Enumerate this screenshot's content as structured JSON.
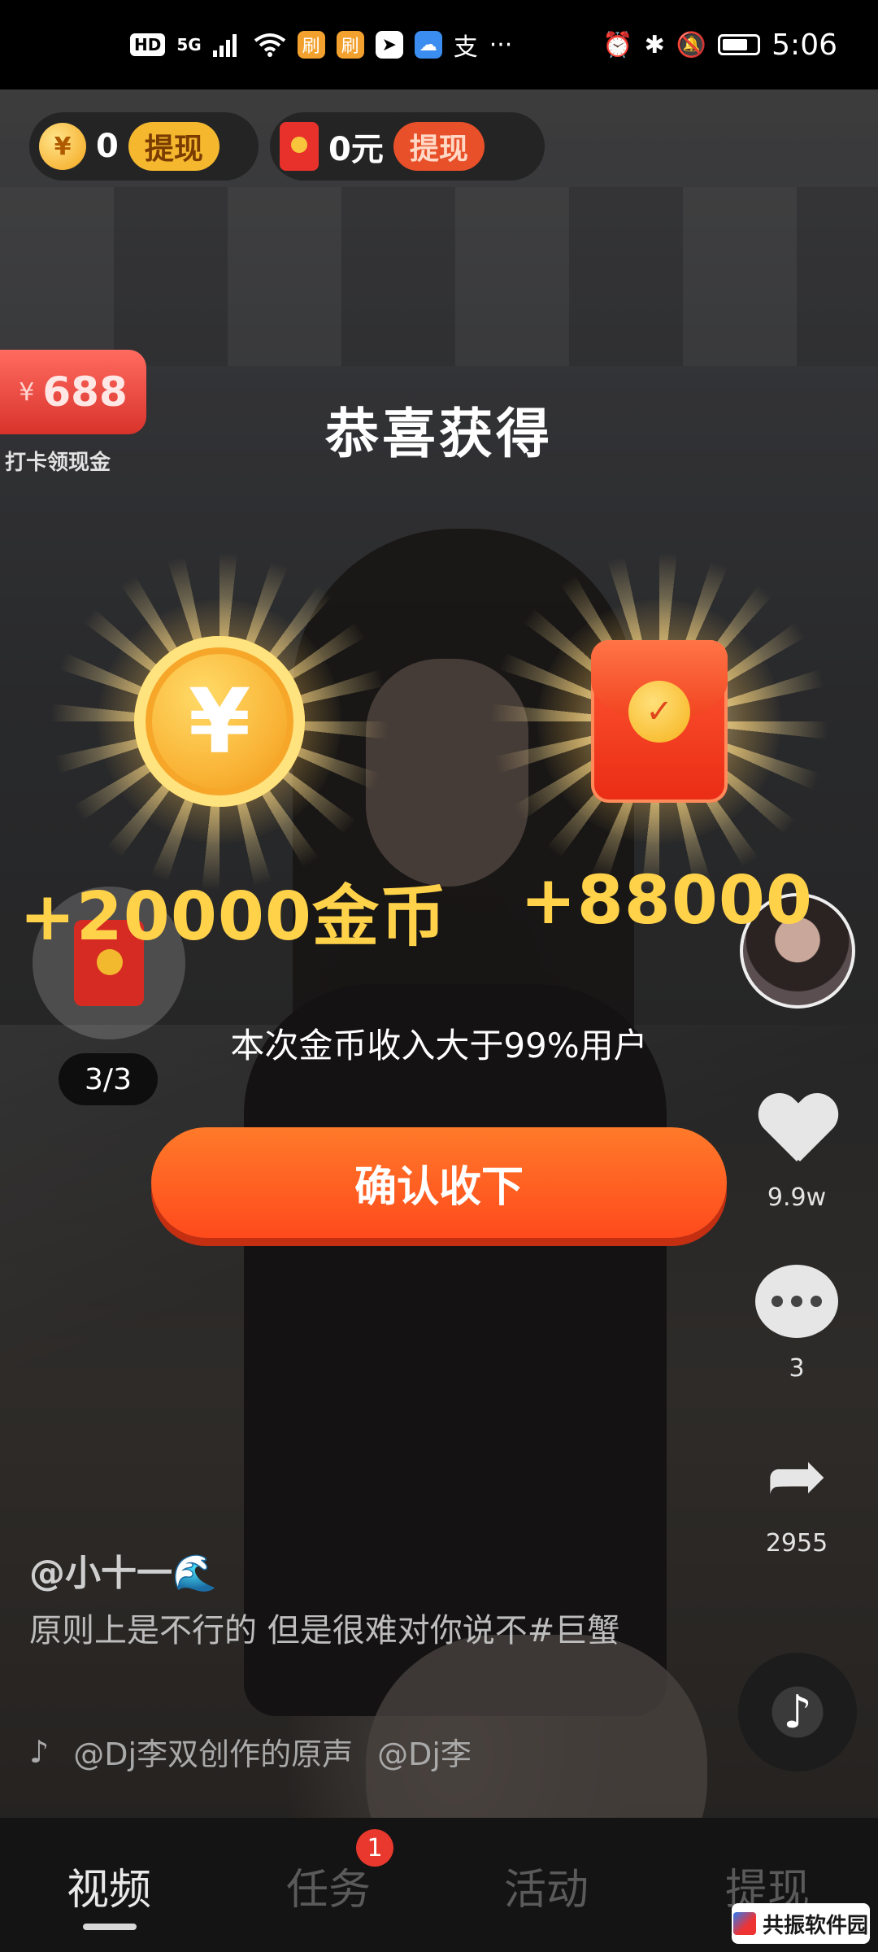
{
  "status_bar": {
    "left_badges": [
      "HD",
      "5G"
    ],
    "app_icon_names": [
      "signal-icon",
      "wifi-icon",
      "brush-app-icon",
      "brush-app-icon",
      "arrow-app-icon",
      "cloud-app-icon",
      "alipay-icon"
    ],
    "more": "···",
    "right_icon_names": [
      "alarm-icon",
      "bluetooth-icon",
      "mute-icon",
      "battery-icon"
    ],
    "time": "5:06"
  },
  "top_chips": {
    "coins": {
      "value": "0",
      "button": "提现"
    },
    "cash": {
      "value": "0元",
      "button": "提现"
    }
  },
  "checkin": {
    "currency": "¥",
    "amount": "688",
    "label": "打卡领现金"
  },
  "task": {
    "progress": "3/3"
  },
  "reward_dialog": {
    "title": "恭喜获得",
    "coin_symbol": "¥",
    "coin_reward": "+20000金币",
    "envelope_reward": "+88000",
    "subtext": "本次金币收入大于99%用户",
    "confirm_label": "确认收下"
  },
  "actions": {
    "likes": "9.9w",
    "comments": "3",
    "shares": "2955"
  },
  "video": {
    "author": "@小十一🌊",
    "caption": "原则上是不行的 但是很难对你说不#巨蟹",
    "music_note": "♪",
    "music_text_1": "@Dj李双创作的原声",
    "music_text_2": "@Dj李"
  },
  "tabs": [
    {
      "label": "视频",
      "active": true
    },
    {
      "label": "任务",
      "badge": "1"
    },
    {
      "label": "活动"
    },
    {
      "label": "提现"
    }
  ],
  "watermark": {
    "text": "共振软件园"
  },
  "colors": {
    "accent_orange": "#ff5a1f",
    "gold_text": "#ffd24a",
    "badge_red": "#e9392e"
  }
}
